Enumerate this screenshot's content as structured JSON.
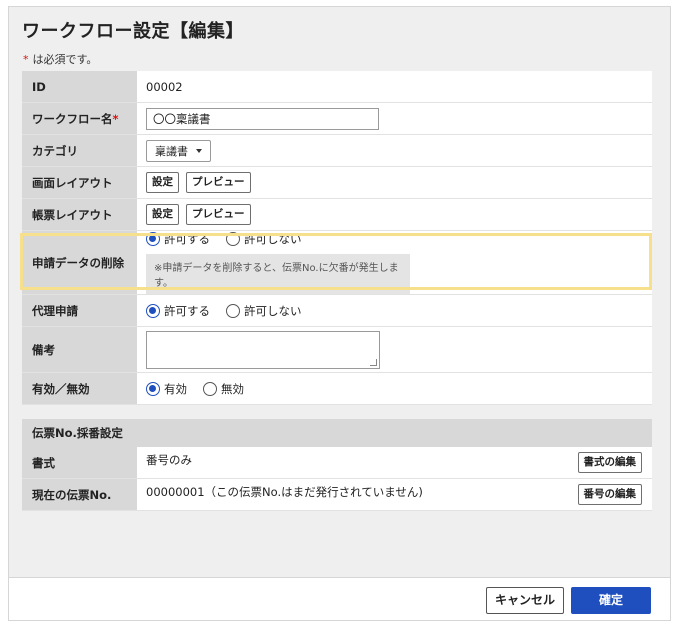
{
  "page": {
    "title": "ワークフロー設定【編集】",
    "required_mark": "*",
    "required_note": "は必須です。"
  },
  "form": {
    "id": {
      "label": "ID",
      "value": "00002"
    },
    "name": {
      "label": "ワークフロー名",
      "required_mark": "*",
      "value": "〇〇稟議書"
    },
    "category": {
      "label": "カテゴリ",
      "selected": "稟議書"
    },
    "screen_layout": {
      "label": "画面レイアウト",
      "settings_label": "設定",
      "preview_label": "プレビュー"
    },
    "slip_layout": {
      "label": "帳票レイアウト",
      "settings_label": "設定",
      "preview_label": "プレビュー"
    },
    "delete_request": {
      "label": "申請データの削除",
      "options": [
        "許可する",
        "許可しない"
      ],
      "selected_index": 0,
      "note": "※申請データを削除すると、伝票No.に欠番が発生します。"
    },
    "proxy": {
      "label": "代理申請",
      "options": [
        "許可する",
        "許可しない"
      ],
      "selected_index": 0
    },
    "remarks": {
      "label": "備考",
      "value": ""
    },
    "active": {
      "label": "有効／無効",
      "options": [
        "有効",
        "無効"
      ],
      "selected_index": 0
    }
  },
  "numbering": {
    "heading": "伝票No.採番設定",
    "format": {
      "label": "書式",
      "value": "番号のみ",
      "edit_label": "書式の編集"
    },
    "current": {
      "label": "現在の伝票No.",
      "value": "00000001（この伝票No.はまだ発行されていません)",
      "edit_label": "番号の編集"
    }
  },
  "footer": {
    "cancel_label": "キャンセル",
    "confirm_label": "確定"
  },
  "colors": {
    "accent": "#1f4fbf",
    "highlight": "#f6e08c",
    "required": "#dd1111"
  }
}
